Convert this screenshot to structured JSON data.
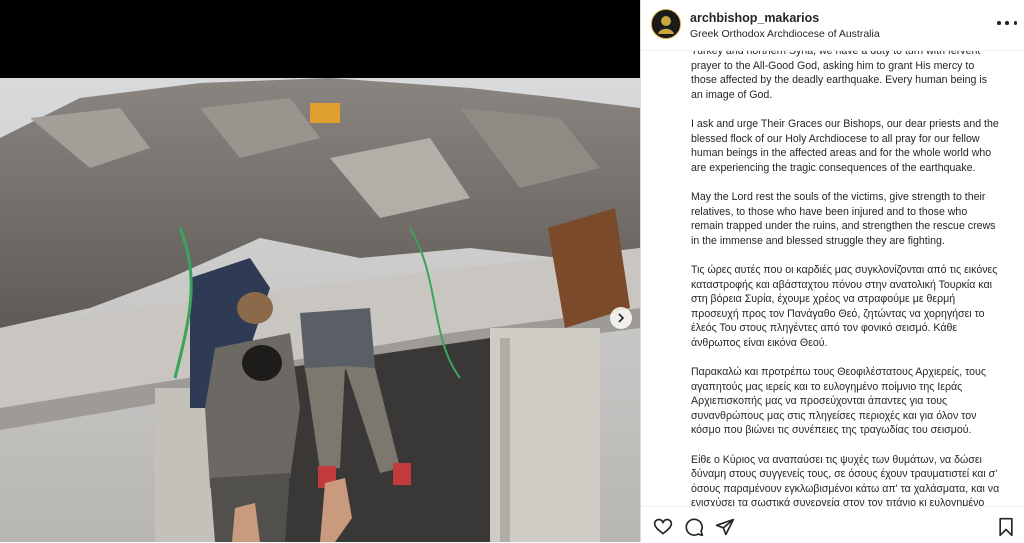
{
  "post": {
    "username": "archbishop_makarios",
    "subtitle": "Greek Orthodox Archdiocese of Australia",
    "caption_paragraphs": [
      "Turkey and northern Syria, we have a duty to turn with fervent prayer to the All-Good God, asking him to grant His mercy to those affected by the deadly earthquake. Every human being is an image of God.",
      "I ask and urge Their Graces our Bishops, our dear priests and the blessed flock of our Holy Archdiocese to all pray for our fellow human beings in the affected areas and for the whole world who are experiencing the tragic consequences of the earthquake.",
      "May the Lord rest the souls of the victims, give strength to their relatives, to those who have been injured and to those who remain trapped under the ruins, and strengthen the rescue crews in the immense and blessed struggle they are fighting.",
      "Τις ώρες αυτές που οι καρδιές μας συγκλονίζονται από τις εικόνες καταστροφής και αβάσταχτου πόνου στην ανατολική Τουρκία και στη βόρεια Συρία, έχουμε χρέος να στραφούμε με θερμή προσευχή προς τον Πανάγαθο Θεό, ζητώντας να χορηγήσει το έλεός Του στους πληγέντες από τον φονικό σεισμό. Κάθε άνθρωπος είναι εικόνα Θεού.",
      "Παρακαλώ και προτρέπω τους Θεοφιλέστατους Αρχιερείς, τους αγαπητούς μας ιερείς και το ευλογημένο ποίμνιο της Ιεράς Αρχιεπισκοπής μας να προσεύχονται άπαντες για τους συνανθρώπους μας στις πληγείσες περιοχές και για όλον τον κόσμο που βιώνει τις συνέπειες της τραγωδίας του σεισμού.",
      "Είθε ο Κύριος να αναπαύσει τις ψυχές των θυμάτων, να δώσει δύναμη στους συγγενείς τους, σε όσους έχουν τραυματιστεί και σ' όσους παραμένουν εγκλωβισμένοι κάτω απ' τα χαλάσματα, και να ενισχύσει τα σωστικά συνεργεία στον τον τιτάνιο κι ευλογημένο αγώνα που δίνουν."
    ]
  },
  "icons": {
    "more": "more-options-icon",
    "like": "heart-icon",
    "comment": "comment-icon",
    "share": "share-icon",
    "save": "bookmark-icon",
    "next": "chevron-right-icon"
  },
  "colors": {
    "text": "#262626",
    "border": "#dbdbdb",
    "avatar_ring": "#c9a640"
  }
}
